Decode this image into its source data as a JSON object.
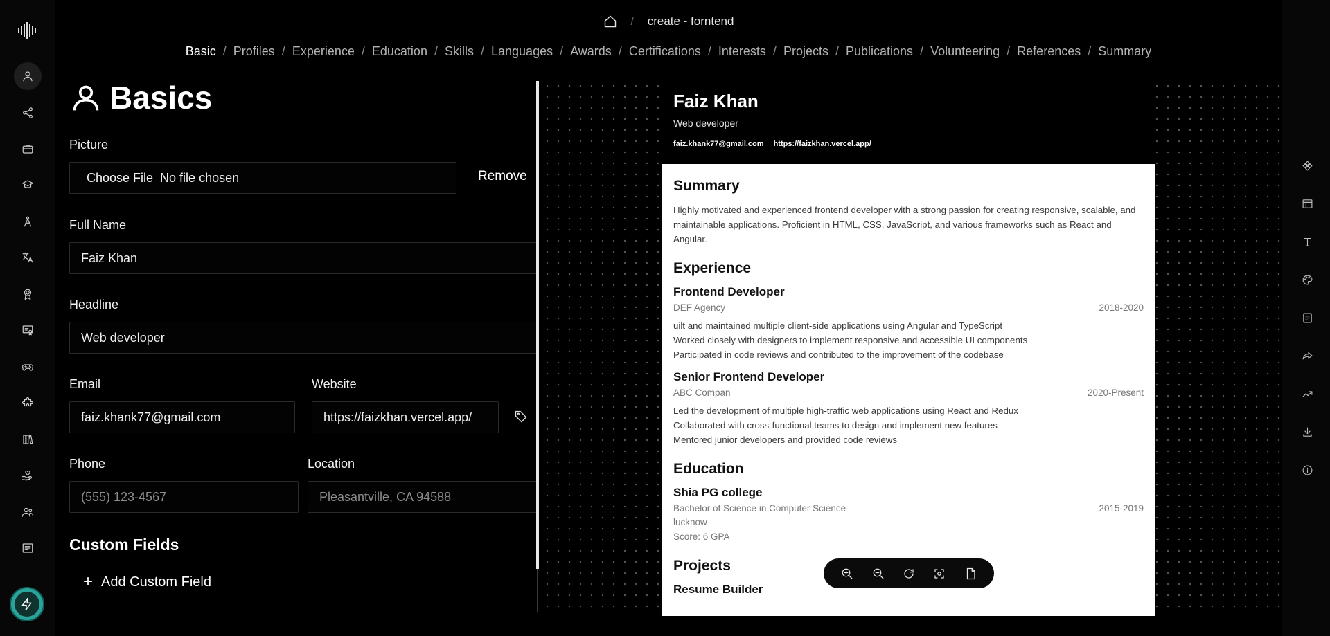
{
  "topbar": {
    "doc_title": "create - forntend",
    "separator": "/"
  },
  "section_nav": [
    {
      "label": "Basic",
      "active": true
    },
    {
      "label": "Profiles"
    },
    {
      "label": "Experience"
    },
    {
      "label": "Education"
    },
    {
      "label": "Skills"
    },
    {
      "label": "Languages"
    },
    {
      "label": "Awards"
    },
    {
      "label": "Certifications"
    },
    {
      "label": "Interests"
    },
    {
      "label": "Projects"
    },
    {
      "label": "Publications"
    },
    {
      "label": "Volunteering"
    },
    {
      "label": "References"
    },
    {
      "label": "Summary"
    }
  ],
  "left_sidebar": {
    "icons": [
      "user-icon",
      "share-icon",
      "briefcase-icon",
      "graduation-cap-icon",
      "skill-icon",
      "languages-icon",
      "award-icon",
      "certificate-icon",
      "gamepad-icon",
      "puzzle-icon",
      "books-icon",
      "volunteer-icon",
      "users-icon",
      "summary-icon"
    ],
    "active": "user-icon"
  },
  "right_sidebar": {
    "icons": [
      "template-icon",
      "layout-icon",
      "typography-icon",
      "palette-icon",
      "notes-icon",
      "share-icon",
      "statistics-icon",
      "download-icon",
      "info-icon"
    ]
  },
  "editor": {
    "title": "Basics",
    "picture": {
      "label": "Picture",
      "choose_button": "Choose File",
      "file_status": "No file chosen",
      "remove": "Remove"
    },
    "full_name": {
      "label": "Full Name",
      "value": "Faiz Khan"
    },
    "headline": {
      "label": "Headline",
      "value": "Web developer"
    },
    "email": {
      "label": "Email",
      "value": "faiz.khank77@gmail.com"
    },
    "website": {
      "label": "Website",
      "value": "https://faizkhan.vercel.app/"
    },
    "phone": {
      "label": "Phone",
      "placeholder": "(555) 123-4567"
    },
    "location": {
      "label": "Location",
      "placeholder": "Pleasantville, CA 94588"
    },
    "custom_fields": {
      "title": "Custom Fields",
      "add": "Add Custom Field"
    }
  },
  "resume": {
    "name": "Faiz Khan",
    "headline": "Web developer",
    "email": "faiz.khank77@gmail.com",
    "website": "https://faizkhan.vercel.app/",
    "summary_title": "Summary",
    "summary_text": "Highly motivated and experienced frontend developer with a strong passion for creating responsive, scalable, and maintainable applications. Proficient in HTML, CSS, JavaScript, and various frameworks such as React and Angular.",
    "experience_title": "Experience",
    "experience": [
      {
        "role": "Frontend Developer",
        "company": "DEF Agency",
        "dates": "2018-2020",
        "bullets": [
          "uilt and maintained multiple client-side applications using Angular and TypeScript",
          "Worked closely with designers to implement responsive and accessible UI components",
          "Participated in code reviews and contributed to the improvement of the codebase"
        ]
      },
      {
        "role": "Senior Frontend Developer",
        "company": "ABC Compan",
        "dates": "2020-Present",
        "bullets": [
          "Led the development of multiple high-traffic web applications using React and Redux",
          "Collaborated with cross-functional teams to design and implement new features",
          "Mentored junior developers and provided code reviews"
        ]
      }
    ],
    "education_title": "Education",
    "education": {
      "school": "Shia PG college",
      "degree": "Bachelor of Science in Computer Science",
      "dates": "2015-2019",
      "location": "lucknow",
      "score": "Score: 6 GPA"
    },
    "projects_title": "Projects",
    "project_first": "Resume Builder"
  },
  "zoom_toolbar": [
    "zoom-in-icon",
    "zoom-out-icon",
    "reset-icon",
    "center-icon",
    "pdf-icon"
  ],
  "colors": {
    "background": "#000000",
    "text": "#ffffff",
    "resume_paper": "#ffffff",
    "resume_header": "#000000"
  }
}
